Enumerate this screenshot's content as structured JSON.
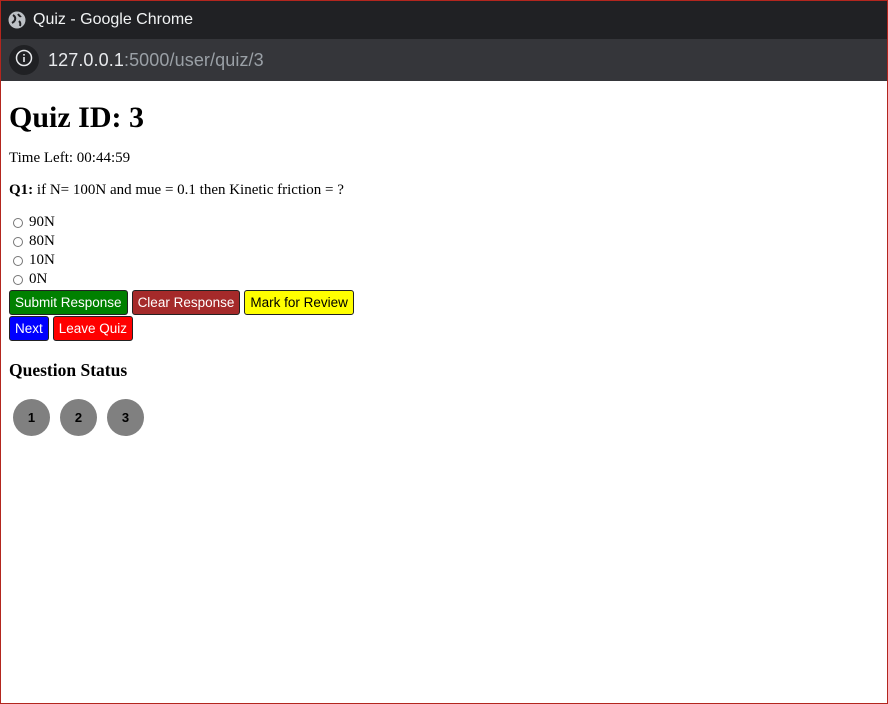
{
  "window": {
    "title": "Quiz - Google Chrome"
  },
  "address_bar": {
    "host": "127.0.0.1",
    "path": ":5000/user/quiz/3"
  },
  "page": {
    "heading": "Quiz ID: 3",
    "timer_label": "Time Left:",
    "timer_value": "00:44:59",
    "question_label": "Q1:",
    "question_text": "if N= 100N and mue = 0.1 then Kinetic friction = ?",
    "options": [
      "90N",
      "80N",
      "10N",
      "0N"
    ],
    "buttons": {
      "submit": "Submit Response",
      "clear": "Clear Response",
      "review": "Mark for Review",
      "next": "Next",
      "leave": "Leave Quiz"
    },
    "status_heading": "Question Status",
    "question_numbers": [
      "1",
      "2",
      "3"
    ]
  },
  "colors": {
    "submit": "#008000",
    "clear": "#a52a2a",
    "review": "#ffff00",
    "next": "#0000ff",
    "leave": "#ff0000",
    "status_circle": "#808080"
  }
}
